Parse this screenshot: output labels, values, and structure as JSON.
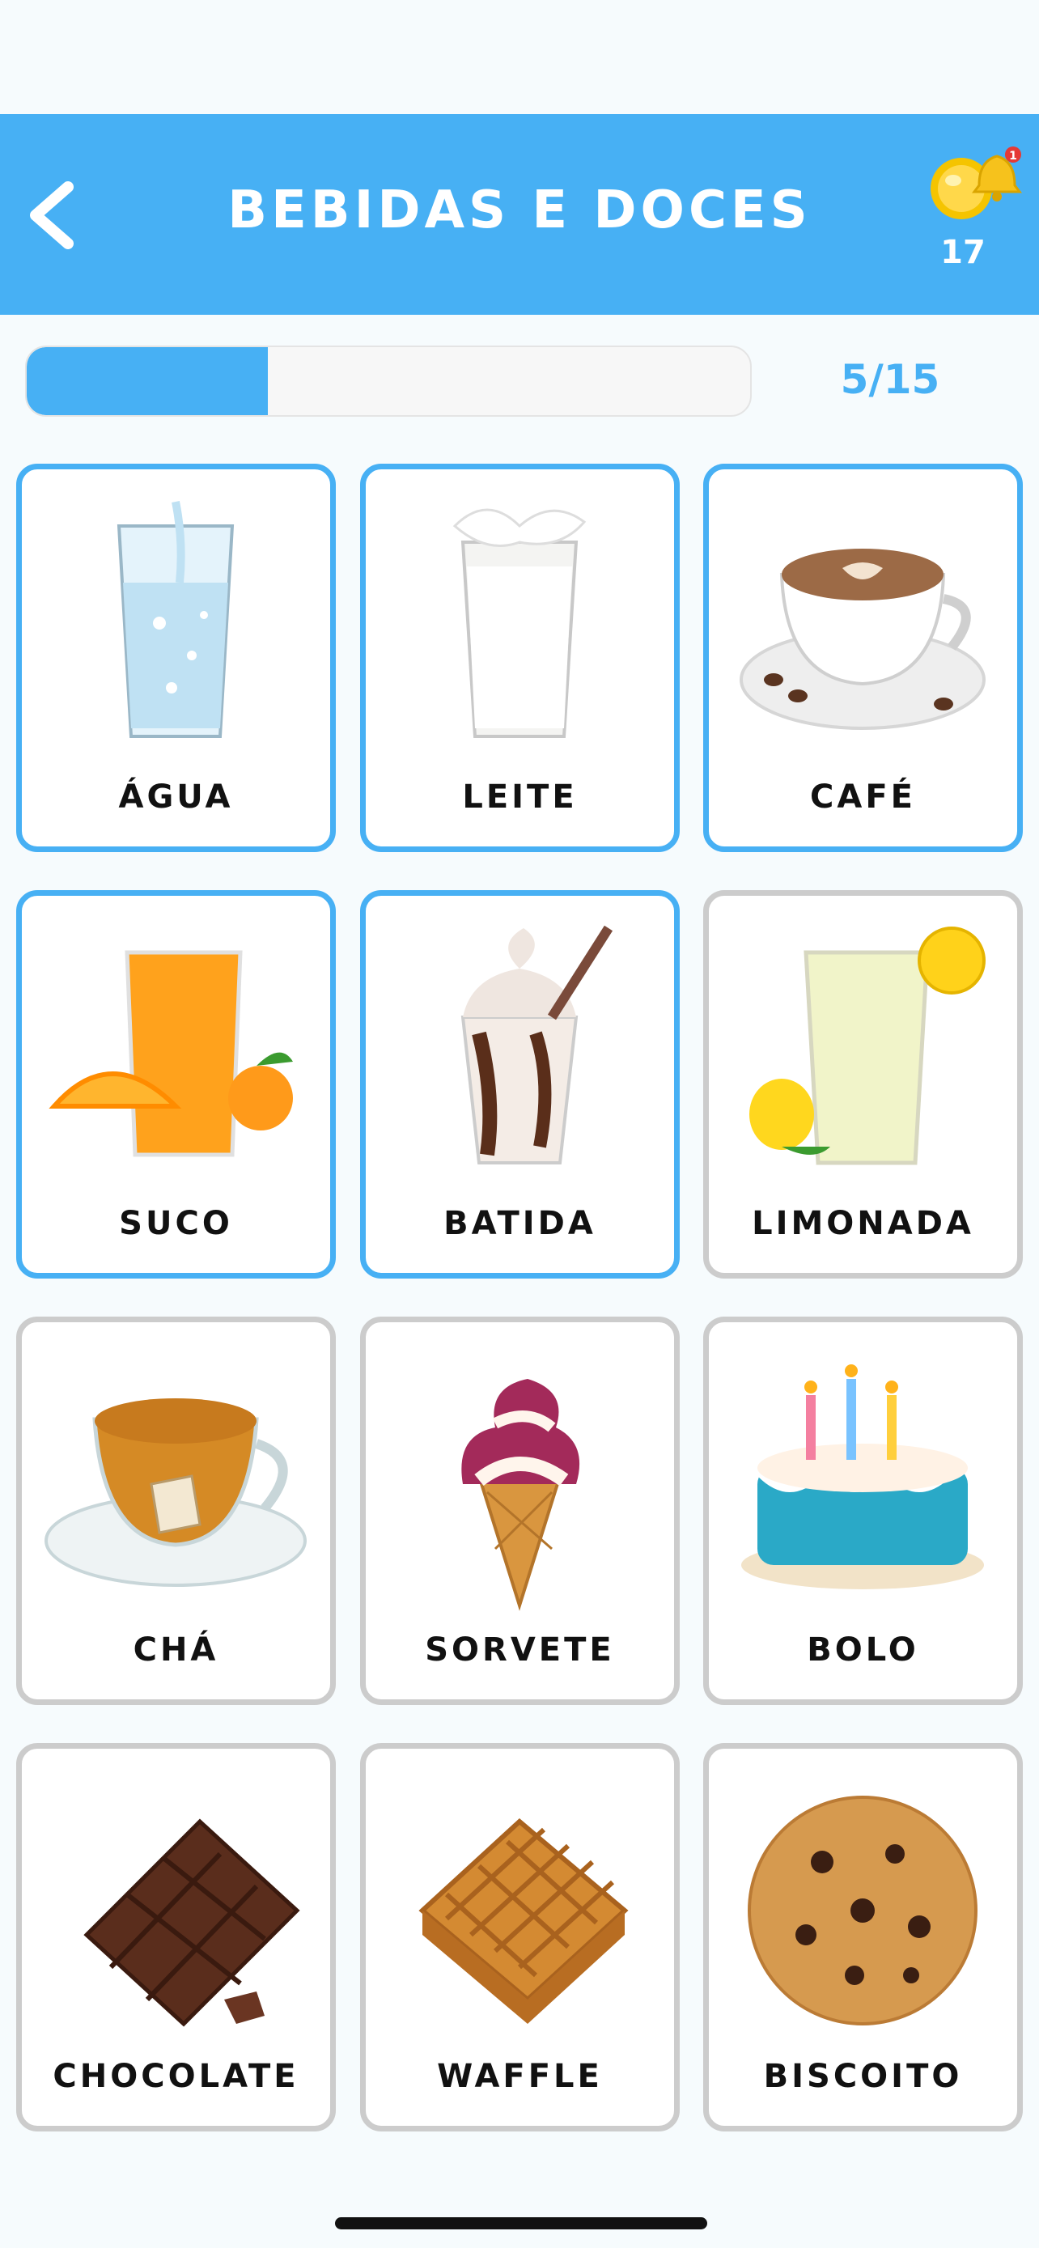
{
  "header": {
    "title": "BEBIDAS E DOCES",
    "coins": "17",
    "back_icon": "chevron-left-icon",
    "coin_icon": "coin-icon",
    "bell_icon": "bell-icon",
    "bell_badge": "1"
  },
  "progress": {
    "current": 5,
    "total": 15,
    "label": "5/15"
  },
  "colors": {
    "accent": "#47b0f4",
    "card_border": "#cccccc",
    "background": "#f6fbfd"
  },
  "items": [
    {
      "label": "ÁGUA",
      "selected": true,
      "icon": "water-glass-icon"
    },
    {
      "label": "LEITE",
      "selected": true,
      "icon": "milk-glass-icon"
    },
    {
      "label": "CAFÉ",
      "selected": true,
      "icon": "coffee-cup-icon"
    },
    {
      "label": "SUCO",
      "selected": true,
      "icon": "orange-juice-icon"
    },
    {
      "label": "BATIDA",
      "selected": true,
      "icon": "milkshake-icon"
    },
    {
      "label": "LIMONADA",
      "selected": false,
      "icon": "lemonade-icon"
    },
    {
      "label": "CHÁ",
      "selected": false,
      "icon": "tea-cup-icon"
    },
    {
      "label": "SORVETE",
      "selected": false,
      "icon": "ice-cream-cone-icon"
    },
    {
      "label": "BOLO",
      "selected": false,
      "icon": "birthday-cake-icon"
    },
    {
      "label": "CHOCOLATE",
      "selected": false,
      "icon": "chocolate-bar-icon"
    },
    {
      "label": "WAFFLE",
      "selected": false,
      "icon": "waffle-icon"
    },
    {
      "label": "BISCOITO",
      "selected": false,
      "icon": "cookie-icon"
    }
  ]
}
